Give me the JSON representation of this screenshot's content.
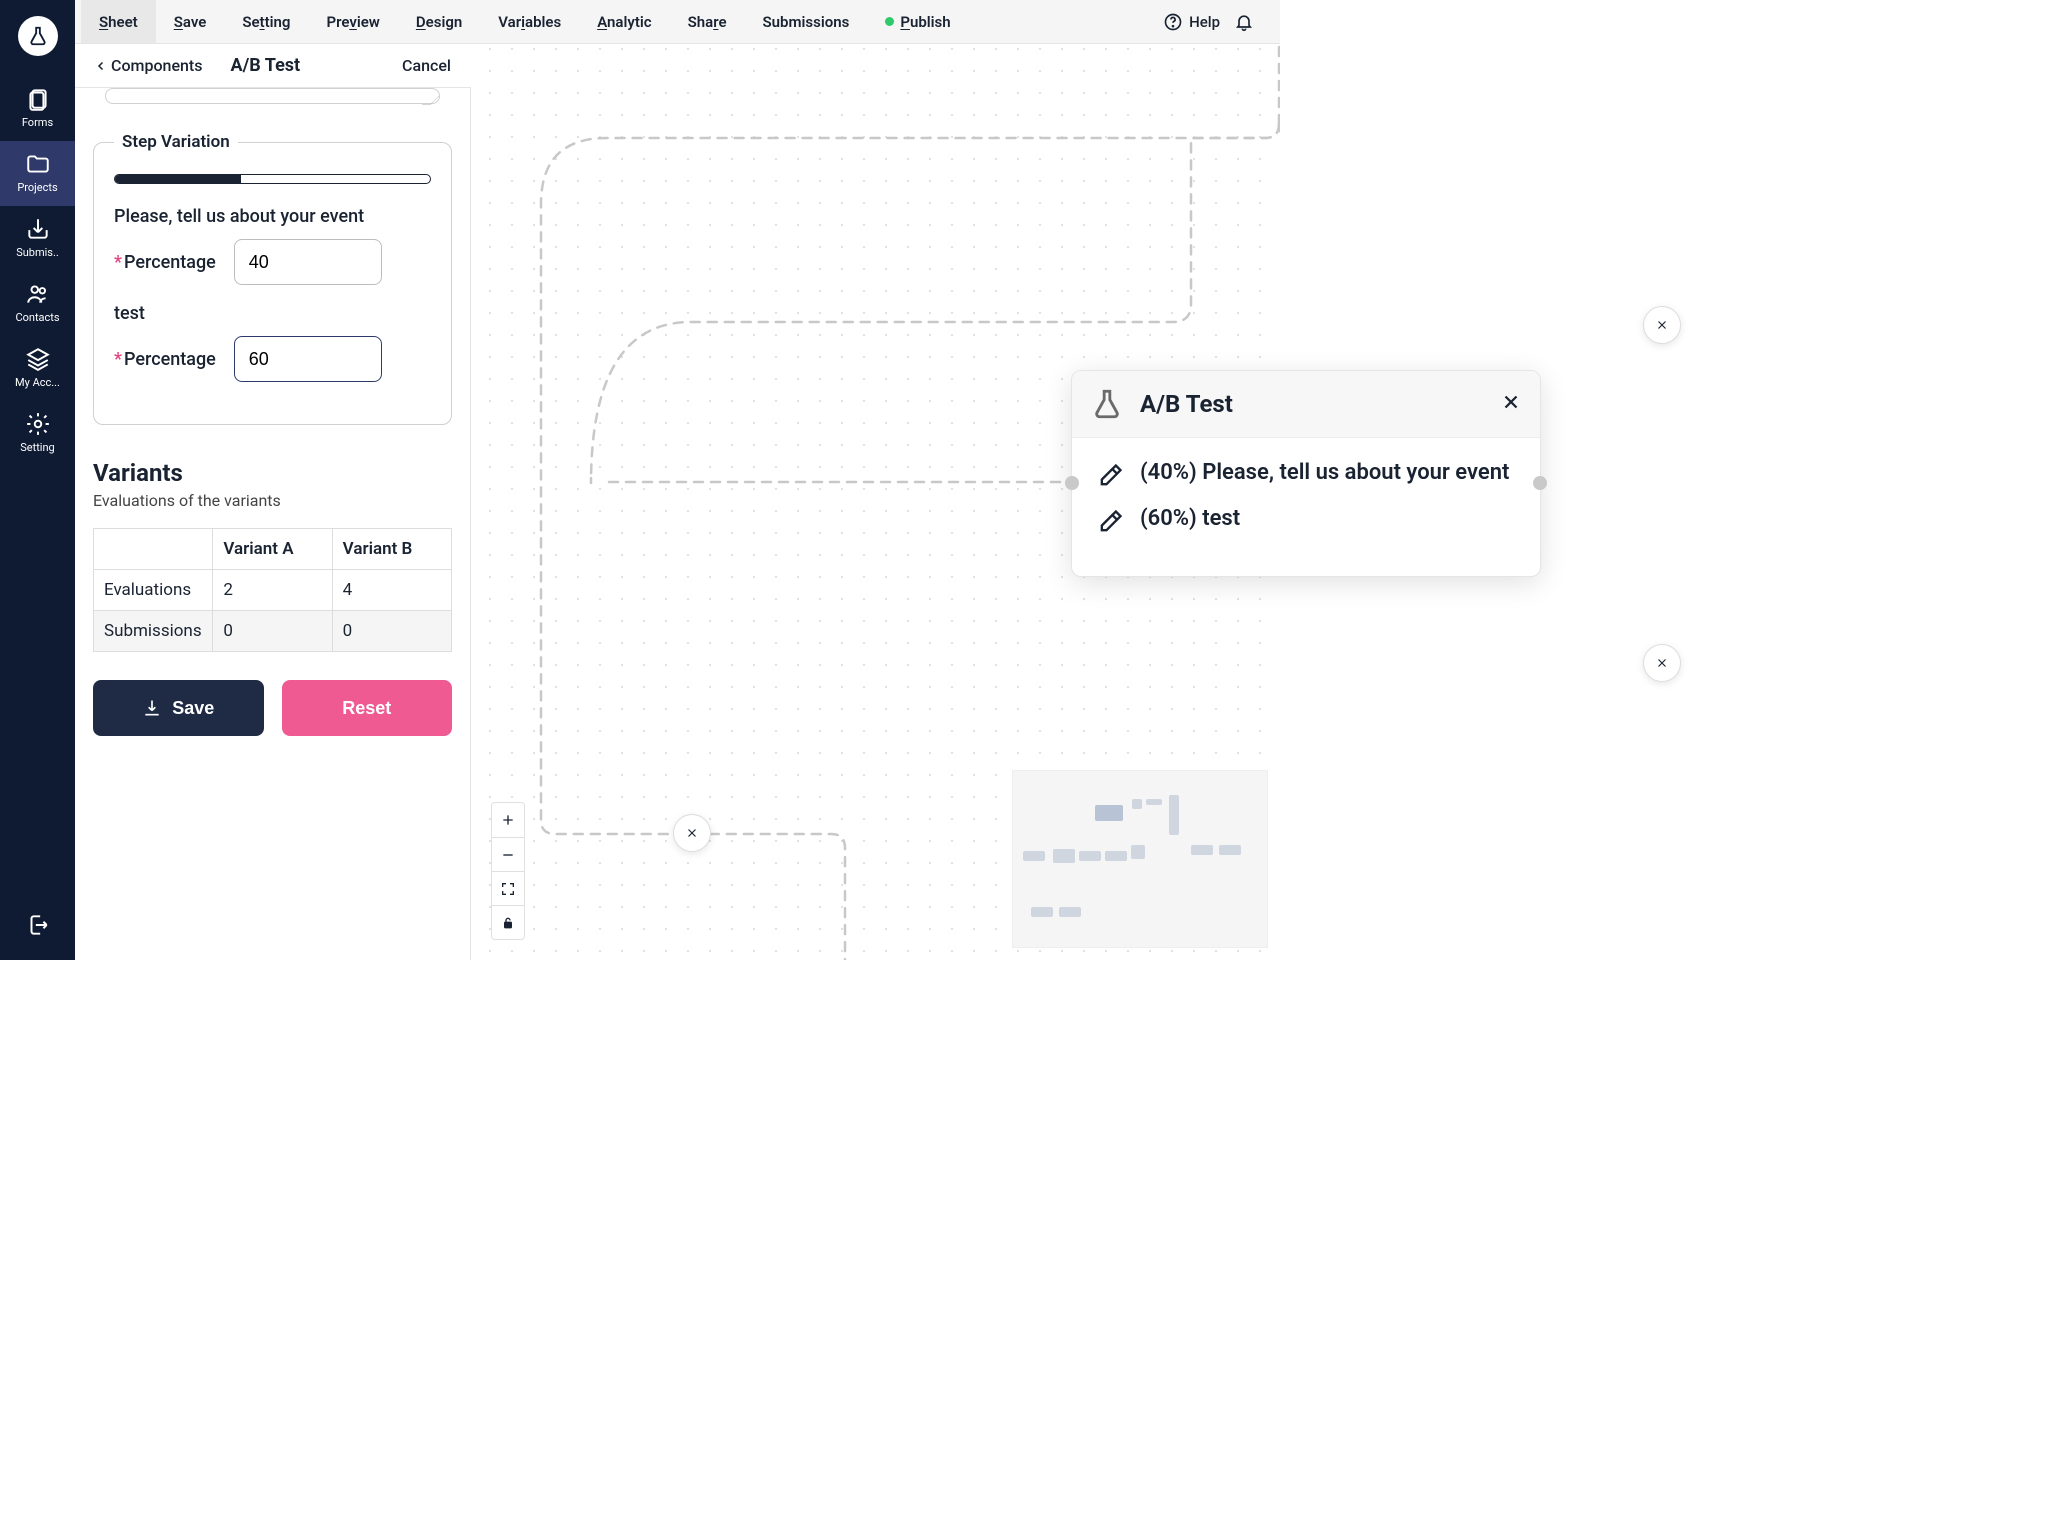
{
  "rail": {
    "items": [
      {
        "label": "Forms"
      },
      {
        "label": "Projects"
      },
      {
        "label": "Submis.."
      },
      {
        "label": "Contacts"
      },
      {
        "label": "My Acc..."
      },
      {
        "label": "Setting"
      }
    ]
  },
  "topbar": {
    "items": [
      "Sheet",
      "Save",
      "Setting",
      "Preview",
      "Design",
      "Variables",
      "Analytic",
      "Share",
      "Submissions",
      "Publish"
    ],
    "help": "Help"
  },
  "panel": {
    "back": "Components",
    "title": "A/B Test",
    "cancel": "Cancel",
    "step_variation_legend": "Step Variation",
    "progress_pct": 40,
    "v1_label": "Please, tell us about your event",
    "v1_pct_label": "Percentage",
    "v1_pct_value": "40",
    "v2_label": "test",
    "v2_pct_label": "Percentage",
    "v2_pct_value": "60",
    "variants_title": "Variants",
    "variants_sub": "Evaluations of the variants",
    "table": {
      "col_blank": "",
      "col_a": "Variant A",
      "col_b": "Variant B",
      "row1": "Evaluations",
      "row1_a": "2",
      "row1_b": "4",
      "row2": "Submissions",
      "row2_a": "0",
      "row2_b": "0"
    },
    "save_btn": "Save",
    "reset_btn": "Reset"
  },
  "node": {
    "title": "A/B Test",
    "line1": "(40%) Please, tell us about your event",
    "line2": "(60%) test"
  }
}
